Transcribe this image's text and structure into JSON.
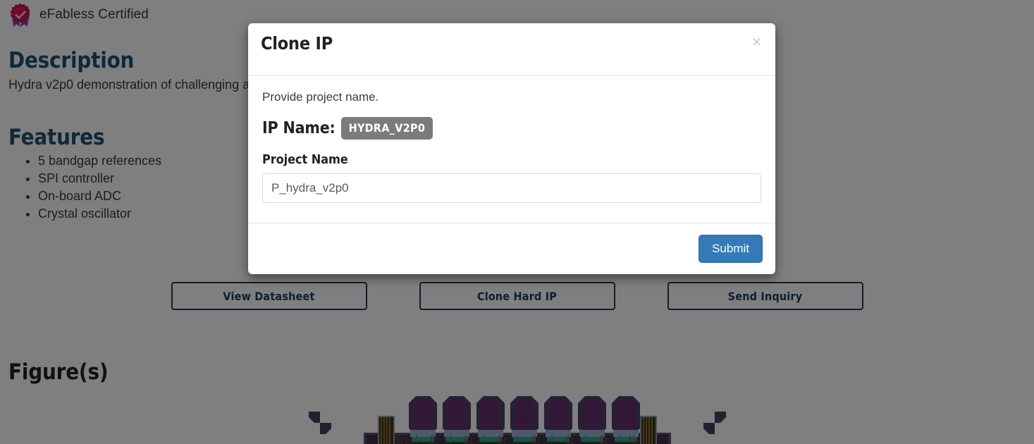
{
  "page": {
    "certification": {
      "icon": "award-badge-icon",
      "label": "eFabless Certified"
    },
    "description": {
      "heading": "Description",
      "text": "Hydra v2p0 demonstration of challenging analog/mixed-signal design"
    },
    "features": {
      "heading": "Features",
      "items": [
        "5 bandgap references",
        "SPI controller",
        "On-board ADC",
        "Crystal oscillator"
      ]
    },
    "actions": [
      {
        "label": "View Datasheet",
        "name": "view-datasheet-button"
      },
      {
        "label": "Clone Hard IP",
        "name": "clone-hard-ip-button"
      },
      {
        "label": "Send Inquiry",
        "name": "send-inquiry-button"
      }
    ],
    "figures": {
      "heading": "Figure(s)",
      "alt": "chip layout figure"
    },
    "colors": {
      "heading_blue": "#1a5276",
      "button_outline": "#1b3f63",
      "badge_pink": "#c2185b",
      "overlay": "#808080"
    }
  },
  "modal": {
    "title": "Clone IP",
    "close_label": "×",
    "note": "Provide project name.",
    "ip_name_label": "IP Name:",
    "ip_name_value": "HYDRA_V2P0",
    "project_name_label": "Project Name",
    "project_name_value": "",
    "project_name_placeholder": "P_hydra_v2p0",
    "submit_label": "Submit",
    "accent_color": "#337ab7"
  }
}
